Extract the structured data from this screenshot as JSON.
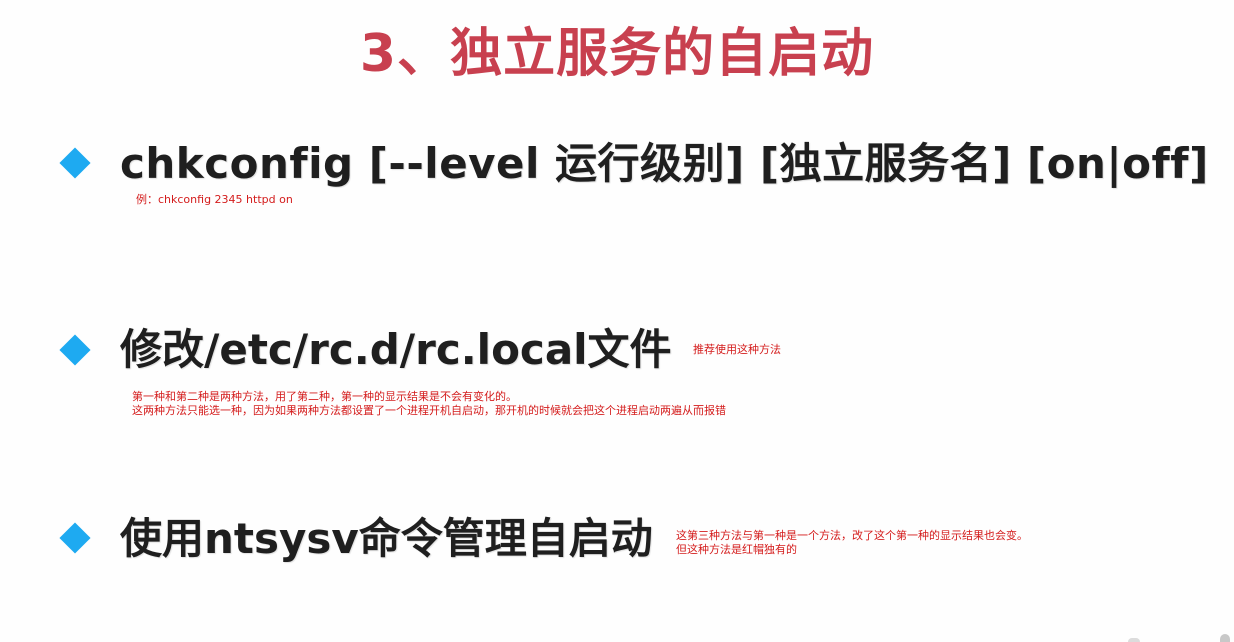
{
  "title": "3、独立服务的自启动",
  "items": [
    {
      "heading": "chkconfig [--level 运行级别] [独立服务名] [on|off]",
      "notes": [
        "例：chkconfig 2345 httpd on"
      ]
    },
    {
      "heading": "修改/etc/rc.d/rc.local文件",
      "side_note": "推荐使用这种方法",
      "notes": [
        "第一种和第二种是两种方法，用了第二种，第一种的显示结果是不会有变化的。",
        "这两种方法只能选一种，因为如果两种方法都设置了一个进程开机自启动，那开机的时候就会把这个进程启动两遍从而报错"
      ]
    },
    {
      "heading": "使用ntsysv命令管理自启动",
      "notes": [
        "这第三种方法与第一种是一个方法，改了这个第一种的显示结果也会变。",
        "但这种方法是红帽独有的"
      ]
    }
  ],
  "colors": {
    "title": "#c8404f",
    "bullet": "#1eaaf1",
    "heading": "#1f1f1f",
    "note": "#d41c1c"
  }
}
